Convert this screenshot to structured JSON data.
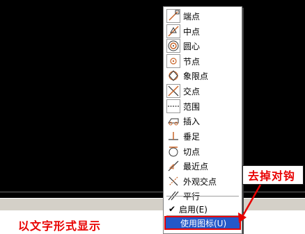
{
  "menu": {
    "items": [
      {
        "label": "端点",
        "icon": "endpoint-icon"
      },
      {
        "label": "中点",
        "icon": "midpoint-icon"
      },
      {
        "label": "圆心",
        "icon": "center-icon"
      },
      {
        "label": "节点",
        "icon": "node-icon"
      },
      {
        "label": "象限点",
        "icon": "quadrant-icon"
      },
      {
        "label": "交点",
        "icon": "intersection-icon"
      },
      {
        "label": "范围",
        "icon": "extension-icon"
      },
      {
        "label": "插入",
        "icon": "insertion-icon"
      },
      {
        "label": "垂足",
        "icon": "perpendicular-icon"
      },
      {
        "label": "切点",
        "icon": "tangent-icon"
      },
      {
        "label": "最近点",
        "icon": "nearest-icon"
      },
      {
        "label": "外观交点",
        "icon": "apparent-intersection-icon"
      },
      {
        "label": "平行",
        "icon": "parallel-icon"
      }
    ],
    "enable": {
      "label": "启用(E)",
      "checked": true
    },
    "use_icons": {
      "label": "使用图标(U)",
      "highlighted": true
    }
  },
  "annotation": {
    "label": "去掉对钩",
    "color": "#e80000"
  },
  "caption": {
    "label": "以文字形式显示",
    "color": "#e80000"
  },
  "colors": {
    "canvas": "#000000",
    "menu_highlight": "#2458c8",
    "accent": "#e60000",
    "icon_stroke": "#c86428"
  }
}
